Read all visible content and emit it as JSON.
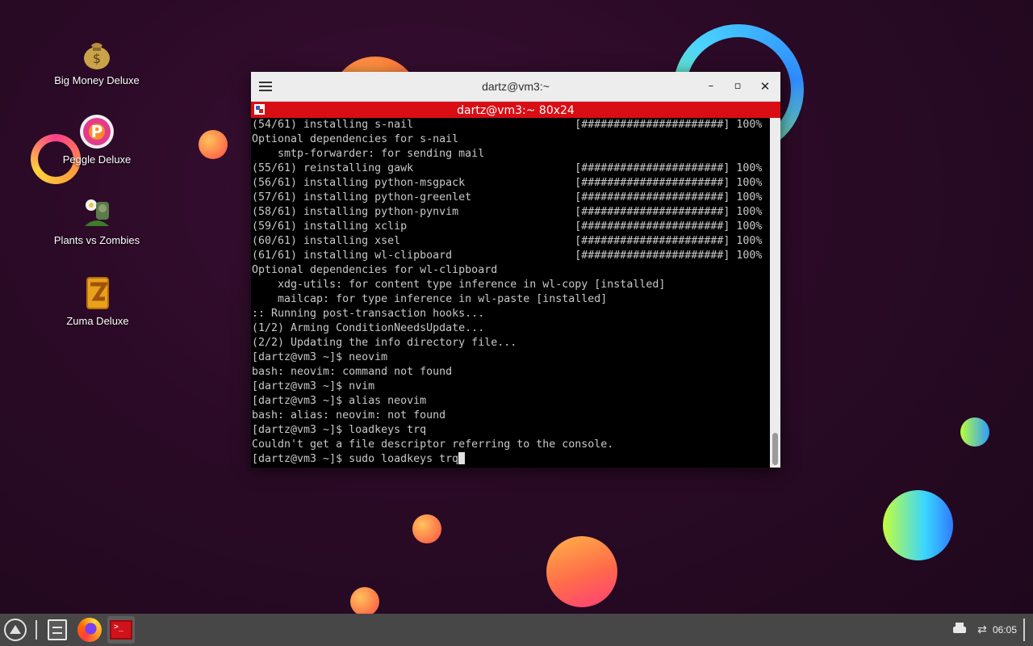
{
  "desktop": {
    "icons": [
      {
        "label": "Big Money Deluxe",
        "icon": "money-bag-icon"
      },
      {
        "label": "Peggle Deluxe",
        "icon": "peggle-icon"
      },
      {
        "label": "Plants vs Zombies",
        "icon": "plants-vs-zombies-icon"
      },
      {
        "label": "Zuma Deluxe",
        "icon": "zuma-icon"
      }
    ]
  },
  "window": {
    "title": "dartz@vm3:~",
    "tab_title": "dartz@vm3:~ 80x24",
    "controls": {
      "minimize": "–",
      "maximize": "▫",
      "close": "✕"
    }
  },
  "terminal": {
    "lines": [
      "(54/61) installing s-nail                         [######################] 100%",
      "Optional dependencies for s-nail",
      "    smtp-forwarder: for sending mail",
      "(55/61) reinstalling gawk                         [######################] 100%",
      "(56/61) installing python-msgpack                 [######################] 100%",
      "(57/61) installing python-greenlet                [######################] 100%",
      "(58/61) installing python-pynvim                  [######################] 100%",
      "(59/61) installing xclip                          [######################] 100%",
      "(60/61) installing xsel                           [######################] 100%",
      "(61/61) installing wl-clipboard                   [######################] 100%",
      "Optional dependencies for wl-clipboard",
      "    xdg-utils: for content type inference in wl-copy [installed]",
      "    mailcap: for type inference in wl-paste [installed]",
      ":: Running post-transaction hooks...",
      "(1/2) Arming ConditionNeedsUpdate...",
      "(2/2) Updating the info directory file...",
      "[dartz@vm3 ~]$ neovim",
      "bash: neovim: command not found",
      "[dartz@vm3 ~]$ nvim",
      "[dartz@vm3 ~]$ alias neovim",
      "bash: alias: neovim: not found",
      "[dartz@vm3 ~]$ loadkeys trq",
      "Couldn't get a file descriptor referring to the console."
    ],
    "current_input": "[dartz@vm3 ~]$ sudo loadkeys trq"
  },
  "taskbar": {
    "items": [
      {
        "name": "app-launcher",
        "icon": "launcher-icon"
      },
      {
        "name": "file-manager",
        "icon": "file-manager-icon"
      },
      {
        "name": "firefox",
        "icon": "firefox-icon"
      },
      {
        "name": "terminal",
        "icon": "terminal-icon"
      }
    ],
    "tray": {
      "printer_icon": "printer-icon",
      "network_icon": "network-icon",
      "clock": "06:05"
    }
  },
  "colors": {
    "accent_red": "#d90e15",
    "terminal_bg": "#000000",
    "terminal_fg": "#c8c8c8",
    "taskbar_bg": "#474747"
  }
}
